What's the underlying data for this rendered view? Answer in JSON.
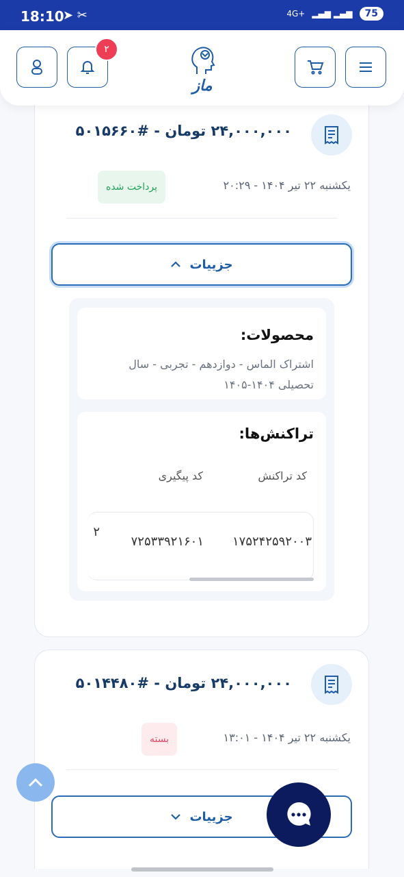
{
  "status_bar": {
    "time": "18:10",
    "network": "4G+",
    "battery": "75"
  },
  "header": {
    "notification_count": "۲",
    "logo_text": "ماز"
  },
  "orders": [
    {
      "title": "۲۴,۰۰۰,۰۰۰ تومان - #۵۰۱۵۶۶۰",
      "datetime": "یکشنبه ۲۲ تیر ۱۴۰۴ - ۲۰:۲۹",
      "status": "پرداخت شده",
      "details_label": "جزییات"
    },
    {
      "title": "۲۴,۰۰۰,۰۰۰ تومان - #۵۰۱۴۴۸۰",
      "datetime": "یکشنبه ۲۲ تیر ۱۴۰۴ - ۱۳:۰۱",
      "status": "بسته",
      "details_label": "جزییات"
    }
  ],
  "details": {
    "products_heading": "محصولات:",
    "products_text": "اشتراک الماس - دوازدهم - تجربی - سال تحصیلی ۱۴۰۴-۱۴۰۵",
    "transactions_heading": "تراکنش‌ها:",
    "columns": [
      "کد تراکنش",
      "کد پیگیری"
    ],
    "row": [
      "۱۷۵۲۴۲۵۹۲۰۰۳",
      "۷۲۵۳۳۹۲۱۶۰۱",
      "۲"
    ]
  },
  "colors": {
    "primary": "#1f5ca6",
    "status_bar": "#1b3ba8",
    "paid_text": "#25a05a",
    "closed_text": "#e24d66",
    "chat_bg": "#0b1b5e"
  },
  "icons": [
    "user-icon",
    "bell-icon",
    "cart-icon",
    "menu-icon",
    "receipt-icon",
    "chevron-up-icon",
    "chevron-down-icon",
    "chat-icon",
    "arrow-up-icon"
  ]
}
